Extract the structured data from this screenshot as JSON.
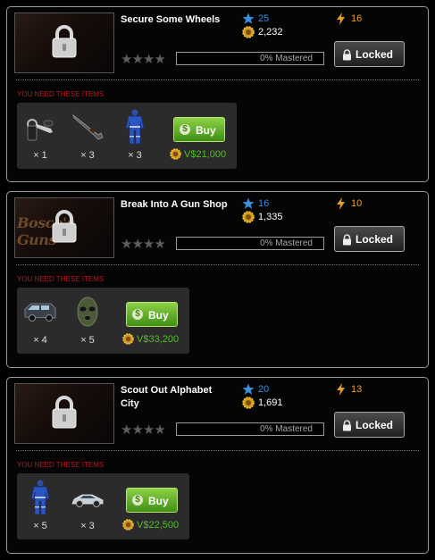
{
  "missions": [
    {
      "title": "Secure Some Wheels",
      "thumb_sign": "",
      "experience": "25",
      "cash": "2,232",
      "energy": "16",
      "mastery_label": "0% Mastered",
      "mastery_fraction": 0,
      "mastery_stars_filled": 0,
      "locked_label": "Locked",
      "need_label": "YOU NEED THESE ITEMS",
      "items": [
        {
          "icon": "car-keys-icon",
          "qty": "× 1"
        },
        {
          "icon": "shotgun-icon",
          "qty": "× 3"
        },
        {
          "icon": "jumpsuit-icon",
          "qty": "× 3"
        }
      ],
      "buy_label": "Buy",
      "price": "V$21,000"
    },
    {
      "title": "Break Into A Gun Shop",
      "thumb_sign": "Bosco's Guns",
      "experience": "16",
      "cash": "1,335",
      "energy": "10",
      "mastery_label": "0% Mastered",
      "mastery_fraction": 0,
      "mastery_stars_filled": 0,
      "locked_label": "Locked",
      "need_label": "YOU NEED THESE ITEMS",
      "items": [
        {
          "icon": "van-icon",
          "qty": "× 4"
        },
        {
          "icon": "ski-mask-icon",
          "qty": "× 5"
        }
      ],
      "buy_label": "Buy",
      "price": "V$33,200"
    },
    {
      "title": "Scout Out Alphabet City",
      "thumb_sign": "",
      "experience": "20",
      "cash": "1,691",
      "energy": "13",
      "mastery_label": "0% Mastered",
      "mastery_fraction": 0,
      "mastery_stars_filled": 0,
      "locked_label": "Locked",
      "need_label": "YOU NEED THESE ITEMS",
      "items": [
        {
          "icon": "jumpsuit-icon",
          "qty": "× 5"
        },
        {
          "icon": "sports-car-icon",
          "qty": "× 3"
        }
      ],
      "buy_label": "Buy",
      "price": "V$22,500"
    }
  ],
  "colors": {
    "experience": "#3b8fe0",
    "energy": "#e8a020",
    "need": "#c1121a",
    "price": "#4fbf27",
    "buy": "#6cb52c"
  }
}
